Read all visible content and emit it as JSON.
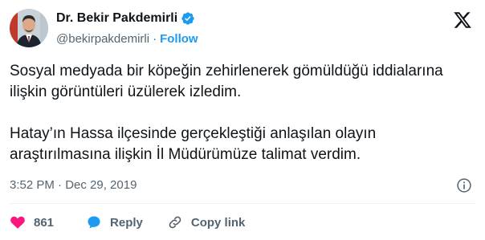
{
  "author": {
    "name": "Dr. Bekir Pakdemirli",
    "handle": "@bekirpakdemirli",
    "separator": "·",
    "follow_label": "Follow"
  },
  "tweet": {
    "paragraphs": [
      "Sosyal medyada bir köpeğin zehirlenerek gömüldüğü iddialarına ilişkin görüntüleri üzülerek izledim.",
      "Hatay’ın Hassa ilçesinde gerçekleştiği anlaşılan olayın araştırılmasına ilişkin İl Müdürümüze talimat verdim."
    ],
    "timestamp": "3:52 PM · Dec 29, 2019"
  },
  "actions": {
    "like_count": "861",
    "reply_label": "Reply",
    "copy_link_label": "Copy link"
  },
  "colors": {
    "like": "#f91880",
    "reply": "#1d9bf0",
    "follow": "#1d9bf0",
    "verified": "#1d9bf0"
  },
  "icons": [
    "x-logo-icon",
    "verified-badge-icon",
    "info-icon",
    "heart-icon",
    "reply-bubble-icon",
    "link-icon"
  ]
}
